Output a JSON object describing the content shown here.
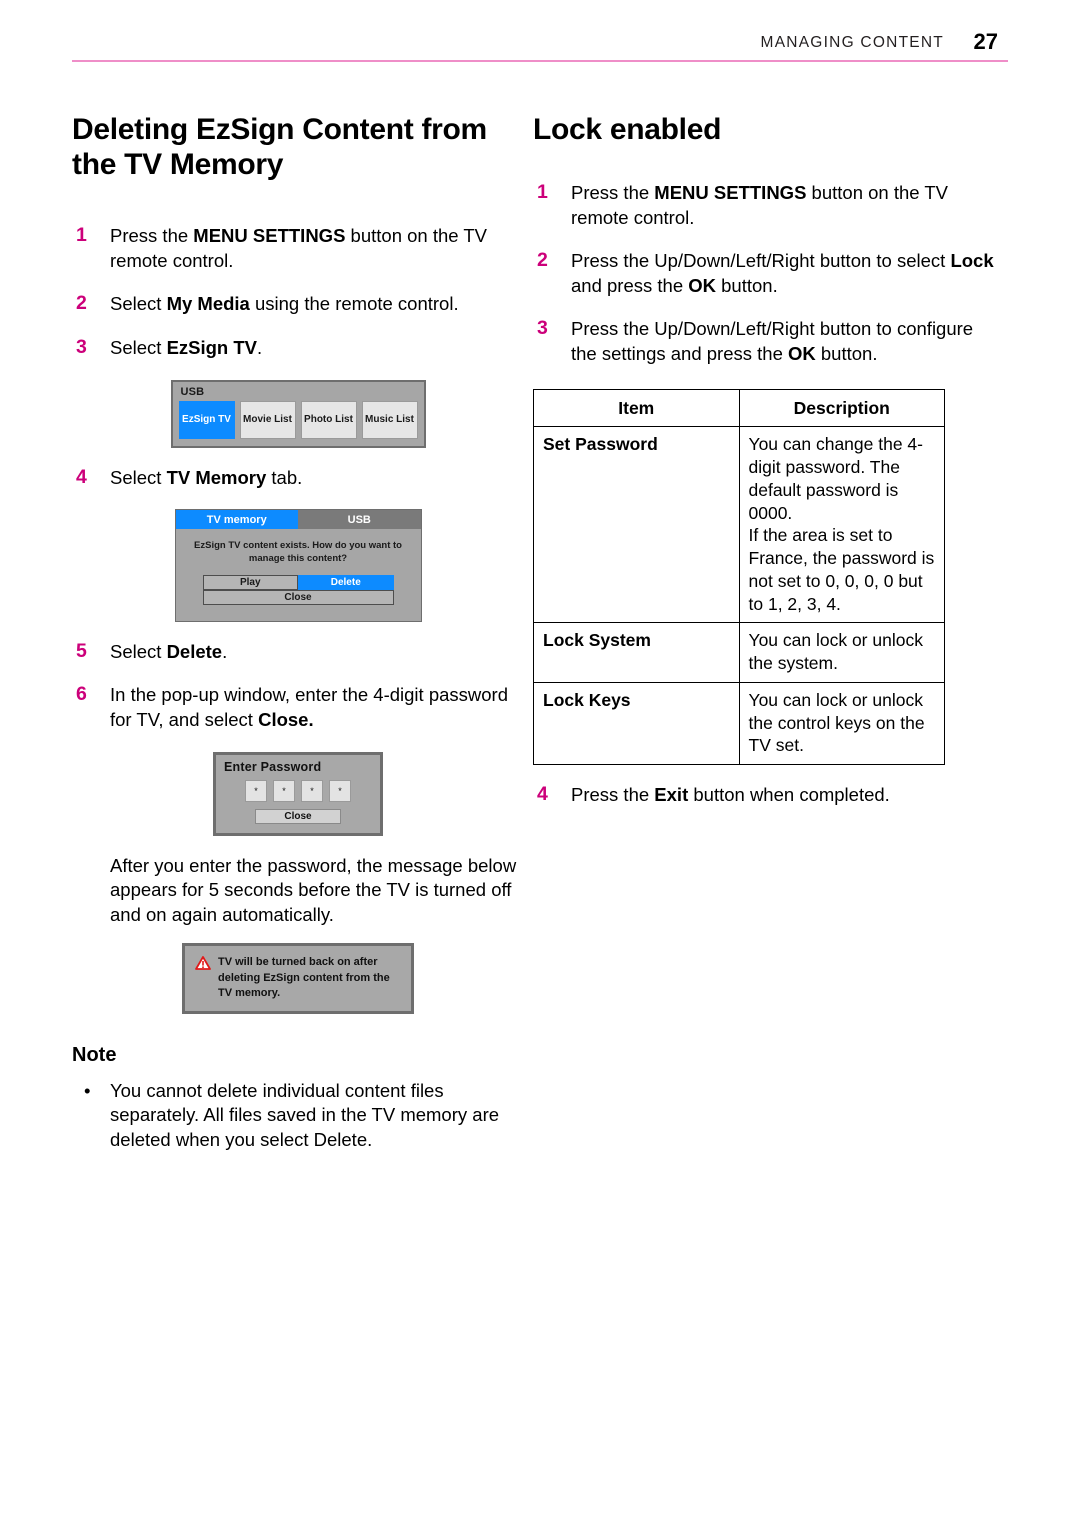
{
  "header": {
    "title": "MANAGING CONTENT",
    "page_number": "27",
    "rule_color": "#ef8ec8"
  },
  "accent_color": "#cc007a",
  "left_column": {
    "heading": "Deleting EzSign Content from the TV Memory",
    "steps": [
      {
        "num": "1",
        "text_html": "Press the <b>MENU SETTINGS</b> button on the TV remote control."
      },
      {
        "num": "2",
        "text_html": "Select <b>My Media</b> using the remote control."
      },
      {
        "num": "3",
        "text_html": "Select <b>EzSign TV</b>."
      },
      {
        "num": "4",
        "text_html": "Select <b>TV Memory</b> tab."
      },
      {
        "num": "5",
        "text_html": "Select <b>Delete</b>."
      },
      {
        "num": "6",
        "text_html": "In the pop-up window, enter the 4-digit password for TV, and select <b>Close.</b>"
      }
    ],
    "after_password_text": "After you enter the password, the message below appears for 5 seconds before the TV is turned off and on again automatically.",
    "usb_figure": {
      "label": "USB",
      "tiles": [
        {
          "label": "EzSign TV",
          "selected": true
        },
        {
          "label": "Movie List",
          "selected": false
        },
        {
          "label": "Photo List",
          "selected": false
        },
        {
          "label": "Music List",
          "selected": false
        }
      ],
      "selected_color": "#0d8bff"
    },
    "tv_memory_figure": {
      "tabs": [
        {
          "label": "TV memory",
          "active": true
        },
        {
          "label": "USB",
          "active": false
        }
      ],
      "message": "EzSign TV content exists. How do you want to manage this content?",
      "buttons": [
        {
          "label": "Play",
          "selected": false
        },
        {
          "label": "Delete",
          "selected": true
        },
        {
          "label": "Close",
          "selected": false
        }
      ]
    },
    "password_figure": {
      "title": "Enter Password",
      "digits": [
        "*",
        "*",
        "*",
        "*"
      ],
      "close_label": "Close"
    },
    "warning_figure": {
      "icon": "warning-triangle-icon",
      "icon_color": "#e01b1b",
      "text": "TV will be turned back on after deleting EzSign content from the TV memory."
    },
    "note": {
      "heading": "Note",
      "bullet": "•",
      "items": [
        "You cannot delete individual content files separately. All files saved in the TV memory are deleted when you select Delete."
      ]
    }
  },
  "right_column": {
    "heading": "Lock enabled",
    "steps_before_table": [
      {
        "num": "1",
        "text_html": "Press the <b>MENU SETTINGS</b> button on the TV remote control."
      },
      {
        "num": "2",
        "text_html": "Press the Up/Down/Left/Right button to select <b>Lock</b> and press the <b>OK</b> button."
      },
      {
        "num": "3",
        "text_html": "Press the Up/Down/Left/Right button to configure the settings and press the <b>OK</b> button."
      }
    ],
    "table": {
      "headers": [
        "Item",
        "Description"
      ],
      "rows": [
        {
          "item": "Set Password",
          "description": "You can change the 4-digit password. The default password is 0000.\nIf the area is set to France, the password is not set to 0, 0, 0, 0 but to 1, 2, 3, 4."
        },
        {
          "item": "Lock System",
          "description": "You can lock or unlock the system."
        },
        {
          "item": "Lock Keys",
          "description": "You can lock or unlock the control keys on the TV set."
        }
      ]
    },
    "steps_after_table": [
      {
        "num": "4",
        "text_html": "Press the <b>Exit</b> button when completed."
      }
    ]
  }
}
